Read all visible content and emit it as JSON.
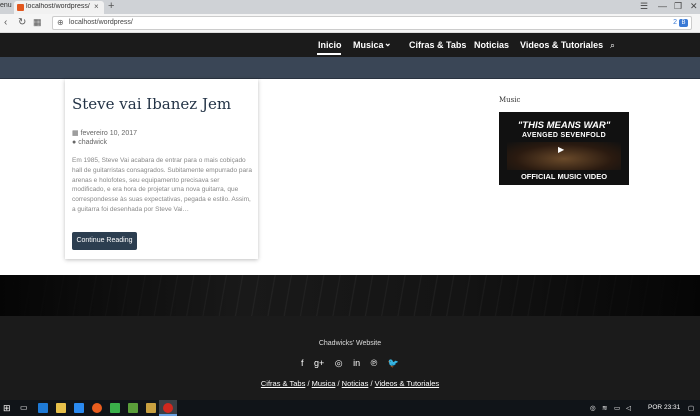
{
  "browser": {
    "menu_label": "enu",
    "tab_title": "localhost/wordpress/?sea",
    "tab_close": "×",
    "new_tab": "+",
    "url": "localhost/wordpress/",
    "url_count": "2",
    "url_badge": "B"
  },
  "nav": {
    "items": [
      "Inicio",
      "Musica",
      "Cifras & Tabs",
      "Noticias",
      "Videos & Tutoriales"
    ],
    "dropdown_glyph": "⌄",
    "search_glyph": "🔍"
  },
  "post": {
    "title": "Steve vai Ibanez Jem",
    "date": "fevereiro 10, 2017",
    "author": "chadwick",
    "excerpt": "Em 1985, Steve Vai acabara de entrar para o mais cobiçado hall de guitarristas consagrados. Subitamente empurrado para arenas e holofotes, seu equipamento precisava ser modificado, e era hora de projetar uma nova guitarra, que correspondesse às suas expectativas, pegada e estilo. Assim, a guitarra foi desenhada por Steve Vai…",
    "read_more": "Continue Reading"
  },
  "sidebar": {
    "title": "Music",
    "video": {
      "top": "\"THIS MEANS WAR\"",
      "sub": "AVENGED SEVENFOLD",
      "bottom": "OFFICIAL MUSIC VIDEO"
    }
  },
  "footer": {
    "site_name": "Chadwicks' Website",
    "social_icons": [
      "facebook-icon",
      "google-plus-icon",
      "instagram-icon",
      "linkedin-icon",
      "pinterest-icon",
      "twitter-icon"
    ],
    "social_glyphs": [
      "f",
      "g+",
      "◎",
      "in",
      "℗",
      "🐦"
    ],
    "links": [
      "Cifras & Tabs",
      "Musica",
      "Noticias",
      "Videos & Tutoriales"
    ],
    "separator": "/"
  },
  "taskbar": {
    "lang": "POR",
    "time": "23:31"
  }
}
